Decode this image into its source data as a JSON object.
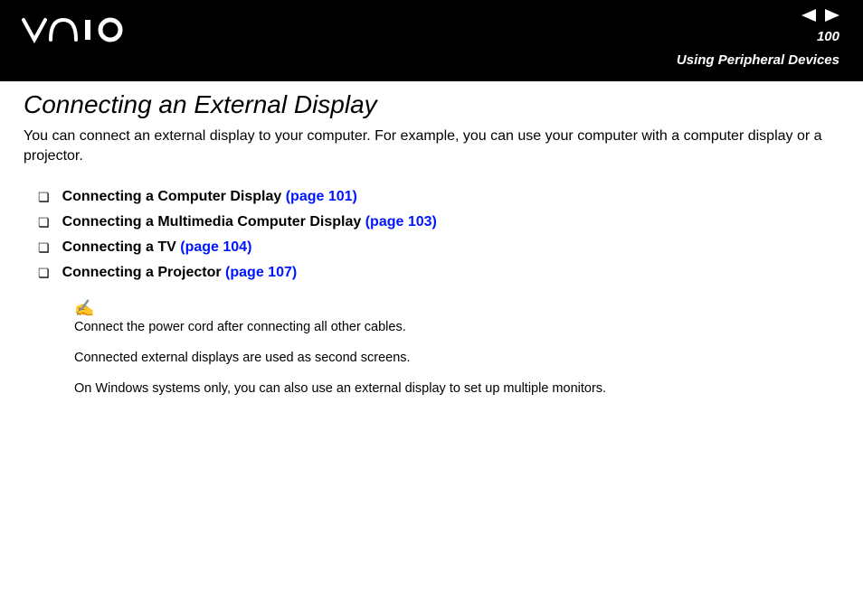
{
  "header": {
    "page_number": "100",
    "section_title": "Using Peripheral Devices"
  },
  "page": {
    "title": "Connecting an External Display",
    "intro": "You can connect an external display to your computer. For example, you can use your computer with a computer display or a projector."
  },
  "toc": [
    {
      "label": "Connecting a Computer Display",
      "link": "(page 101)"
    },
    {
      "label": "Connecting a Multimedia Computer Display",
      "link": "(page 103)"
    },
    {
      "label": "Connecting a TV",
      "link": "(page 104)"
    },
    {
      "label": "Connecting a Projector",
      "link": "(page 107)"
    }
  ],
  "notes": {
    "line1": "Connect the power cord after connecting all other cables.",
    "line2": "Connected external displays are used as second screens.",
    "line3": "On Windows systems only, you can also use an external display to set up multiple monitors."
  }
}
